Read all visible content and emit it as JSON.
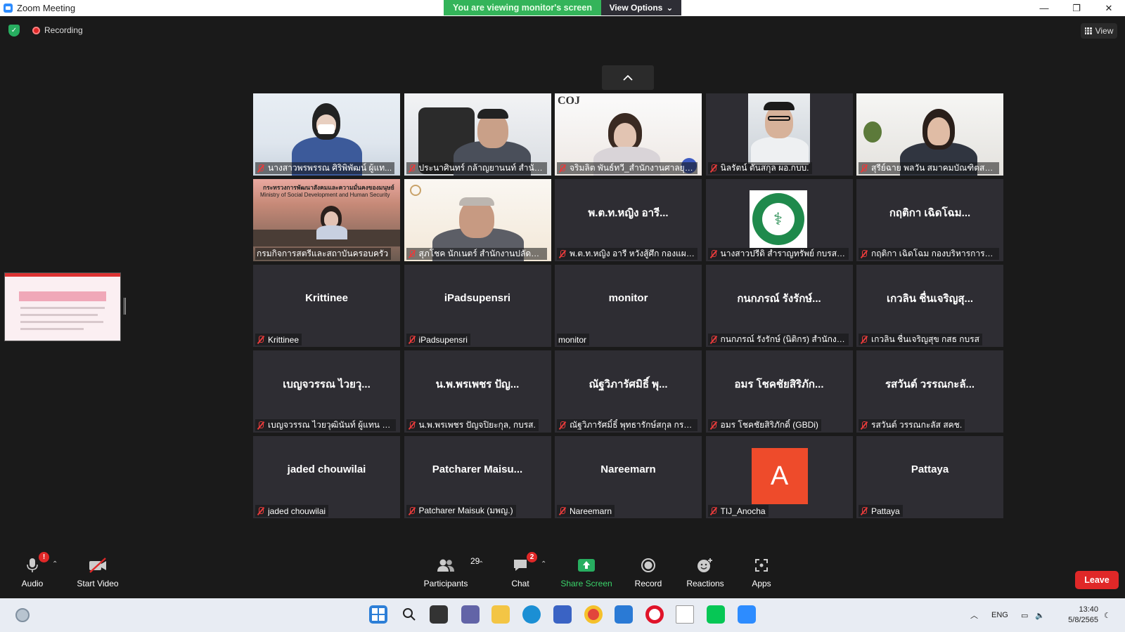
{
  "window": {
    "title": "Zoom Meeting",
    "viewing_banner": "You are viewing monitor's screen",
    "view_options": "View Options",
    "minimize": "—",
    "restore": "❐",
    "close": "✕"
  },
  "status": {
    "recording": "Recording",
    "view_button": "View"
  },
  "tiles": [
    {
      "label": "นางสาวพรพรรณ ศิริพิพัฒน์ ผู้แท...",
      "big": ""
    },
    {
      "label": "ประนาศินทร์ กล้าญยานนท์ สำนักง...",
      "big": ""
    },
    {
      "label": "จริมลิต พันธ์ทวี_สำนักงานศาลยุติธ...",
      "big": ""
    },
    {
      "label": "นิลรัตน์ ตันสกุล ผอ.กบบ.",
      "big": ""
    },
    {
      "label": "สุรีย์ฉาย พลวัน สมาคมบัณฑิตสตรี...",
      "big": ""
    },
    {
      "label": "กรมกิจการสตรีและสถาบันครอบครัว",
      "big": "",
      "screen_title": "กระทรวงการพัฒนาสังคมและความมั่นคงของมนุษย์",
      "screen_sub": "Ministry of Social Development and Human Security"
    },
    {
      "label": "สุภโชค นักเนตร์ สำนักงานปลัดกระทรวงสุ...",
      "big": ""
    },
    {
      "label": "พ.ต.ท.หญิง อารี หวังสู้ศึก กองแผน...",
      "big": "พ.ต.ท.หญิง อารี..."
    },
    {
      "label": "นางสาวปรีดิ สำราญทรัพย์ กบรส.ส...",
      "big": ""
    },
    {
      "label": "กฤติกา เฉิดโฉม กองบริหารการสาธ...",
      "big": "กฤติกา เฉิดโฉม..."
    },
    {
      "label": "Krittinee",
      "big": "Krittinee"
    },
    {
      "label": "iPadsupensri",
      "big": "iPadsupensri"
    },
    {
      "label": "monitor",
      "big": "monitor"
    },
    {
      "label": "กนกภรณ์ รังรักษ์ (นิติกร) สำนักงา...",
      "big": "กนกภรณ์ รังรักษ์..."
    },
    {
      "label": "เกวลิน ชื่นเจริญสุข กสธ กบรส",
      "big": "เกวลิน ชื่นเจริญสุ..."
    },
    {
      "label": "เบญจวรรณ ไวยวุฒินันท์ ผู้แทน สถ.",
      "big": "เบญจวรรณ ไวยวุ..."
    },
    {
      "label": "น.พ.พรเพชร ปัญจปิยะกุล, กบรส.",
      "big": "น.พ.พรเพชร ปัญ..."
    },
    {
      "label": "ณัฐวิภารัศมิ์ธิ์ พุทธารักษ์สกุล กรม...",
      "big": "ณัฐวิภารัศมิธิ์ พุ..."
    },
    {
      "label": "อมร โชคชัยสิริภักดิ์ (GBDi)",
      "big": "อมร โชคชัยสิริภัก..."
    },
    {
      "label": "รสวันต์ วรรณกะลัส สคช.",
      "big": "รสวันต์ วรรณกะลั..."
    },
    {
      "label": "jaded chouwilai",
      "big": "jaded chouwilai"
    },
    {
      "label": "Patcharer Maisuk (มพญ.)",
      "big": "Patcharer  Maisu..."
    },
    {
      "label": "Nareemarn",
      "big": "Nareemarn"
    },
    {
      "label": "TIJ_Anocha",
      "big": "",
      "avatar_letter": "A"
    },
    {
      "label": "Pattaya",
      "big": "Pattaya"
    }
  ],
  "logos": {
    "coj": "COJ",
    "moph_symbol": "⚕"
  },
  "toolbar": {
    "audio": "Audio",
    "audio_badge": "!",
    "start_video": "Start Video",
    "participants": "Participants",
    "participants_count": "29",
    "chat": "Chat",
    "chat_badge": "2",
    "share_screen": "Share Screen",
    "record": "Record",
    "reactions": "Reactions",
    "apps": "Apps",
    "leave": "Leave"
  },
  "taskbar": {
    "lang": "ENG",
    "time": "13:40",
    "date": "5/8/2565"
  },
  "colors": {
    "accent_green": "#34b45a",
    "leave_red": "#e02828",
    "active_speaker": "#d6b24a",
    "share_green": "#3ad46a"
  }
}
